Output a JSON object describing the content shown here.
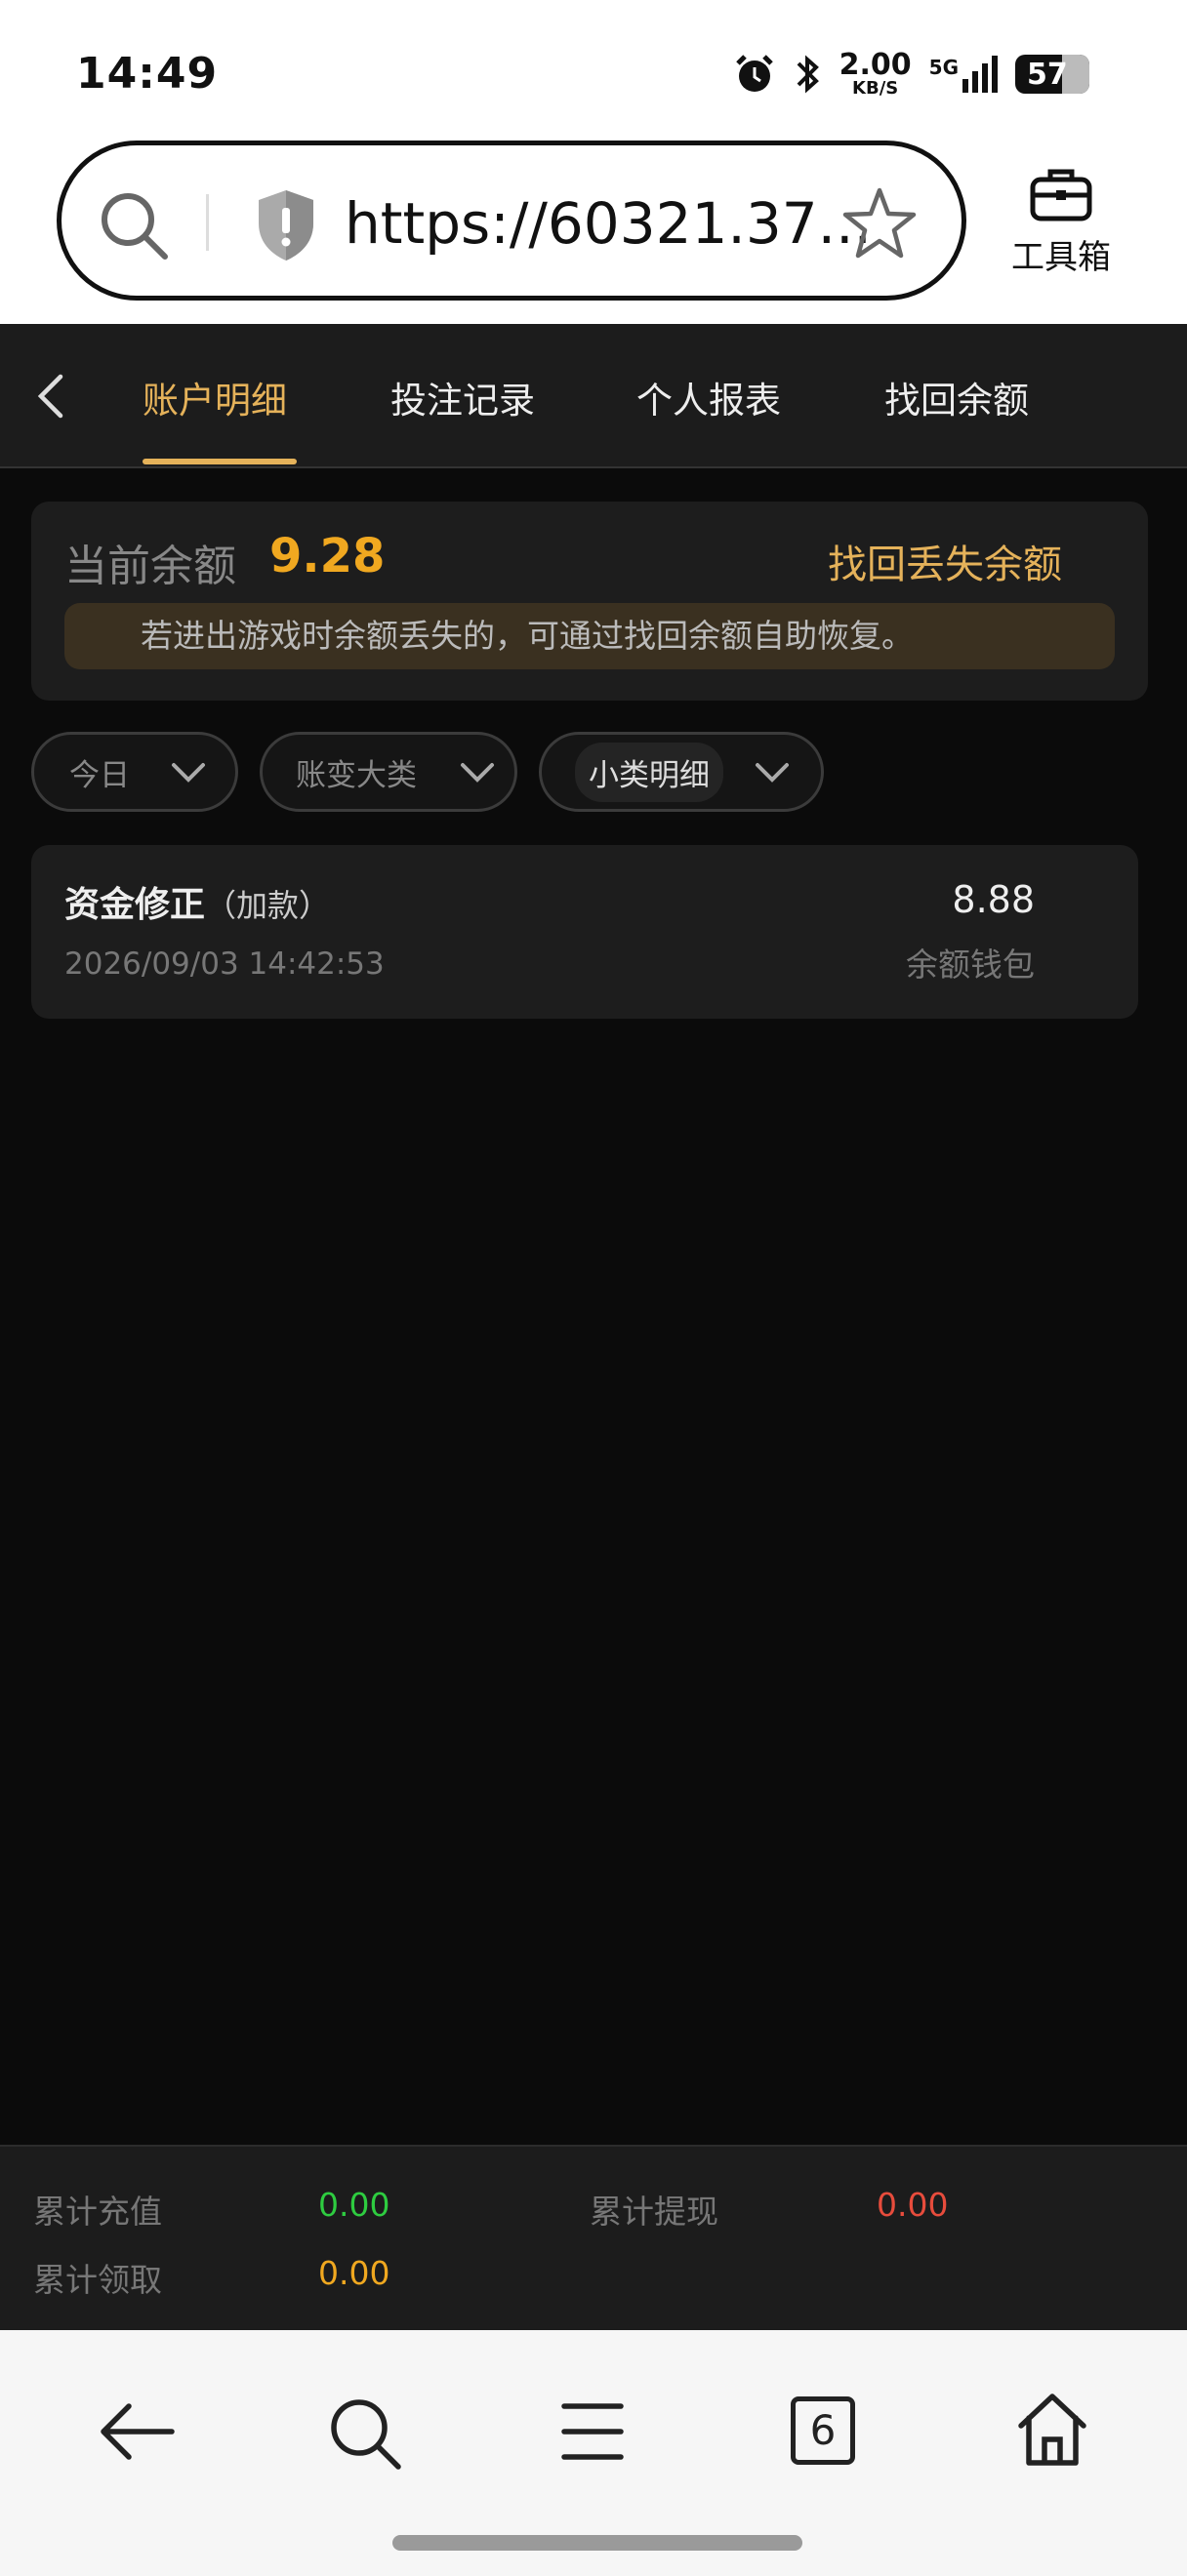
{
  "status": {
    "time": "14:49",
    "net_speed": "2.00",
    "net_unit": "KB/S",
    "network": "5G",
    "battery": "57"
  },
  "browser": {
    "url": "https://60321.37...",
    "toolbox_label": "工具箱"
  },
  "tabs": [
    {
      "label": "账户明细",
      "active": true
    },
    {
      "label": "投注记录",
      "active": false
    },
    {
      "label": "个人报表",
      "active": false
    },
    {
      "label": "找回余额",
      "active": false
    }
  ],
  "balance": {
    "label": "当前余额",
    "value": "9.28",
    "recover_link": "找回丢失余额",
    "notice": "若进出游戏时余额丢失的，可通过找回余额自助恢复。"
  },
  "filters": [
    {
      "label": "今日"
    },
    {
      "label": "账变大类"
    },
    {
      "label": "小类明细"
    }
  ],
  "records": [
    {
      "title": "资金修正",
      "subtitle": "（加款）",
      "time": "2026/09/03 14:42:53",
      "amount": "8.88",
      "wallet": "余额钱包"
    }
  ],
  "totals": {
    "recharge_label": "累计充值",
    "recharge_value": "0.00",
    "withdraw_label": "累计提现",
    "withdraw_value": "0.00",
    "claim_label": "累计领取",
    "claim_value": "0.00"
  },
  "nav": {
    "tab_count": "6"
  },
  "colors": {
    "accent": "#e5b25a",
    "balance": "#f0a820",
    "recharge": "#2ecc40",
    "withdraw": "#e74c3c",
    "claim": "#f0a820"
  }
}
